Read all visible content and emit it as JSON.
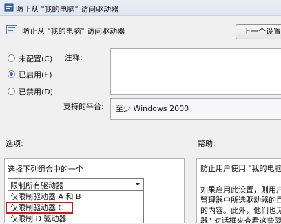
{
  "window": {
    "title": "防止从 \"我的电脑\" 访问驱动器",
    "icon": "policy-settings-icon"
  },
  "header": {
    "title": "防止从 \"我的电脑\" 访问驱动器",
    "prev_button": "上一个设置"
  },
  "state_options": [
    {
      "label": "未配置(C)",
      "checked": false
    },
    {
      "label": "已启用(E)",
      "checked": true
    },
    {
      "label": "已禁用(D)",
      "checked": false
    }
  ],
  "comment": {
    "label": "注释:",
    "value": ""
  },
  "platform": {
    "label": "支持的平台:",
    "value": "至少 Windows 2000"
  },
  "options": {
    "label": "选项:",
    "prompt": "选择下列组合中的一个",
    "selected": "限制所有驱动器",
    "dropdown_items": [
      "仅限制驱动器 A 和 B",
      "仅限制驱动器 C",
      "仅限制 D 驱动器"
    ]
  },
  "help": {
    "label": "帮助:",
    "lines": [
      "防止用户使用 \"我的电脑",
      "",
      "如果启用此设置，则用户",
      "管理器中所选驱动器的目",
      "的内容。此外，他们也无",
      "器\" 对话框来查看这些驱"
    ]
  }
}
